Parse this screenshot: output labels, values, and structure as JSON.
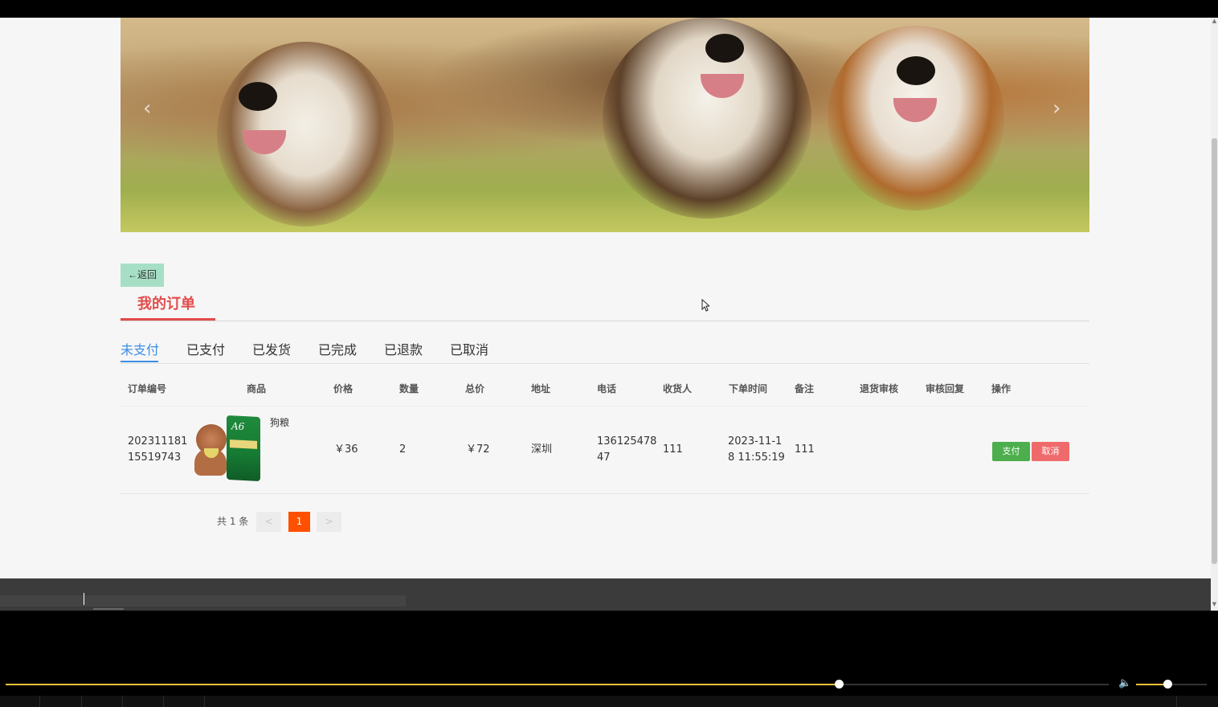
{
  "banner": {
    "prev_arrow": "‹",
    "next_arrow": "›"
  },
  "back_button": {
    "label": "←返回"
  },
  "section_title": "我的订单",
  "tabs": [
    {
      "label": "未支付",
      "active": true
    },
    {
      "label": "已支付"
    },
    {
      "label": "已发货"
    },
    {
      "label": "已完成"
    },
    {
      "label": "已退款"
    },
    {
      "label": "已取消"
    }
  ],
  "table": {
    "headers": [
      "订单编号",
      "商品",
      "价格",
      "数量",
      "总价",
      "地址",
      "电话",
      "收货人",
      "下单时间",
      "备注",
      "退货审核",
      "审核回复",
      "操作"
    ],
    "rows": [
      {
        "order_no_line1": "202311181",
        "order_no_line2": "15519743",
        "product_name": "狗粮",
        "product_bag_text": "A6",
        "price": "￥36",
        "quantity": "2",
        "total": "￥72",
        "address": "深圳",
        "phone_line1": "136125478",
        "phone_line2": "47",
        "receiver": "111",
        "time_line1": "2023-11-1",
        "time_line2": "8 11:55:19",
        "remark": "111",
        "return_review": "",
        "review_reply": "",
        "pay_label": "支付",
        "cancel_label": "取消"
      }
    ]
  },
  "pagination": {
    "total": "共 1 条",
    "prev": "<",
    "current": "1",
    "next": ">"
  },
  "player": {
    "progress": 0.755,
    "volume": 0.44,
    "volume_icon": "speaker-icon"
  },
  "colors": {
    "accent_red": "#e34b4b",
    "tab_active": "#3a8ee6",
    "pay": "#4cae4c",
    "cancel": "#ef6b6b",
    "page_current": "#ff5000",
    "progress": "#e8c23c"
  }
}
